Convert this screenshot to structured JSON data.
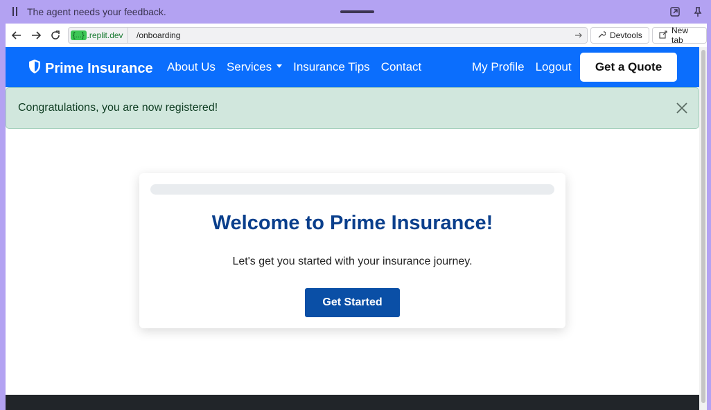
{
  "agent_bar": {
    "message": "The agent needs your feedback."
  },
  "browser": {
    "url_badge": "{...}",
    "url_host": ".replit.dev",
    "url_path": "/onboarding",
    "devtools_label": "Devtools",
    "new_tab_label": "New tab"
  },
  "navbar": {
    "brand": "Prime Insurance",
    "links": [
      "About Us",
      "Services",
      "Insurance Tips",
      "Contact"
    ],
    "right_links": [
      "My Profile",
      "Logout"
    ],
    "cta": "Get a Quote"
  },
  "alert": {
    "message": "Congratulations, you are now registered!"
  },
  "card": {
    "progress_fraction": 0,
    "title": "Welcome to Prime Insurance!",
    "subtitle": "Let's get you started with your insurance journey.",
    "button": "Get Started"
  },
  "colors": {
    "brand_blue": "#0b6efd",
    "dark_blue": "#0a4fa6",
    "success_bg": "#d1e7dd",
    "agent_purple": "#b3a2f2"
  }
}
